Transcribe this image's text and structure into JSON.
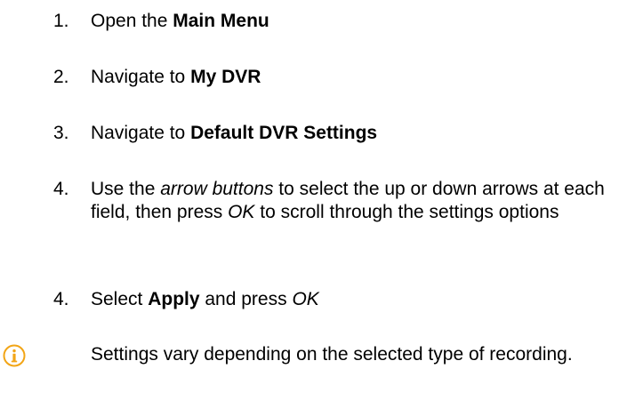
{
  "steps": [
    {
      "num": "1.",
      "parts": [
        {
          "text": "Open the ",
          "style": "normal"
        },
        {
          "text": "Main Menu",
          "style": "bold"
        }
      ]
    },
    {
      "num": "2.",
      "parts": [
        {
          "text": "Navigate to ",
          "style": "normal"
        },
        {
          "text": "My DVR",
          "style": "bold"
        }
      ]
    },
    {
      "num": "3.",
      "parts": [
        {
          "text": "Navigate to ",
          "style": "normal"
        },
        {
          "text": "Default DVR Settings",
          "style": "bold"
        }
      ]
    },
    {
      "num": "4.",
      "parts": [
        {
          "text": "Use the ",
          "style": "normal"
        },
        {
          "text": "arrow buttons",
          "style": "italic"
        },
        {
          "text": " to select the up or down arrows at each field, then press ",
          "style": "normal"
        },
        {
          "text": "OK",
          "style": "italic"
        },
        {
          "text": " to scroll through the settings options",
          "style": "normal"
        }
      ]
    },
    {
      "num": "4.",
      "parts": [
        {
          "text": "Select ",
          "style": "normal"
        },
        {
          "text": "Apply",
          "style": "bold"
        },
        {
          "text": " and press ",
          "style": "normal"
        },
        {
          "text": "OK",
          "style": "italic"
        }
      ]
    }
  ],
  "note": {
    "icon": "info-icon",
    "icon_color": "#f2a516",
    "text": "Settings vary depending on the selected type of recording."
  }
}
